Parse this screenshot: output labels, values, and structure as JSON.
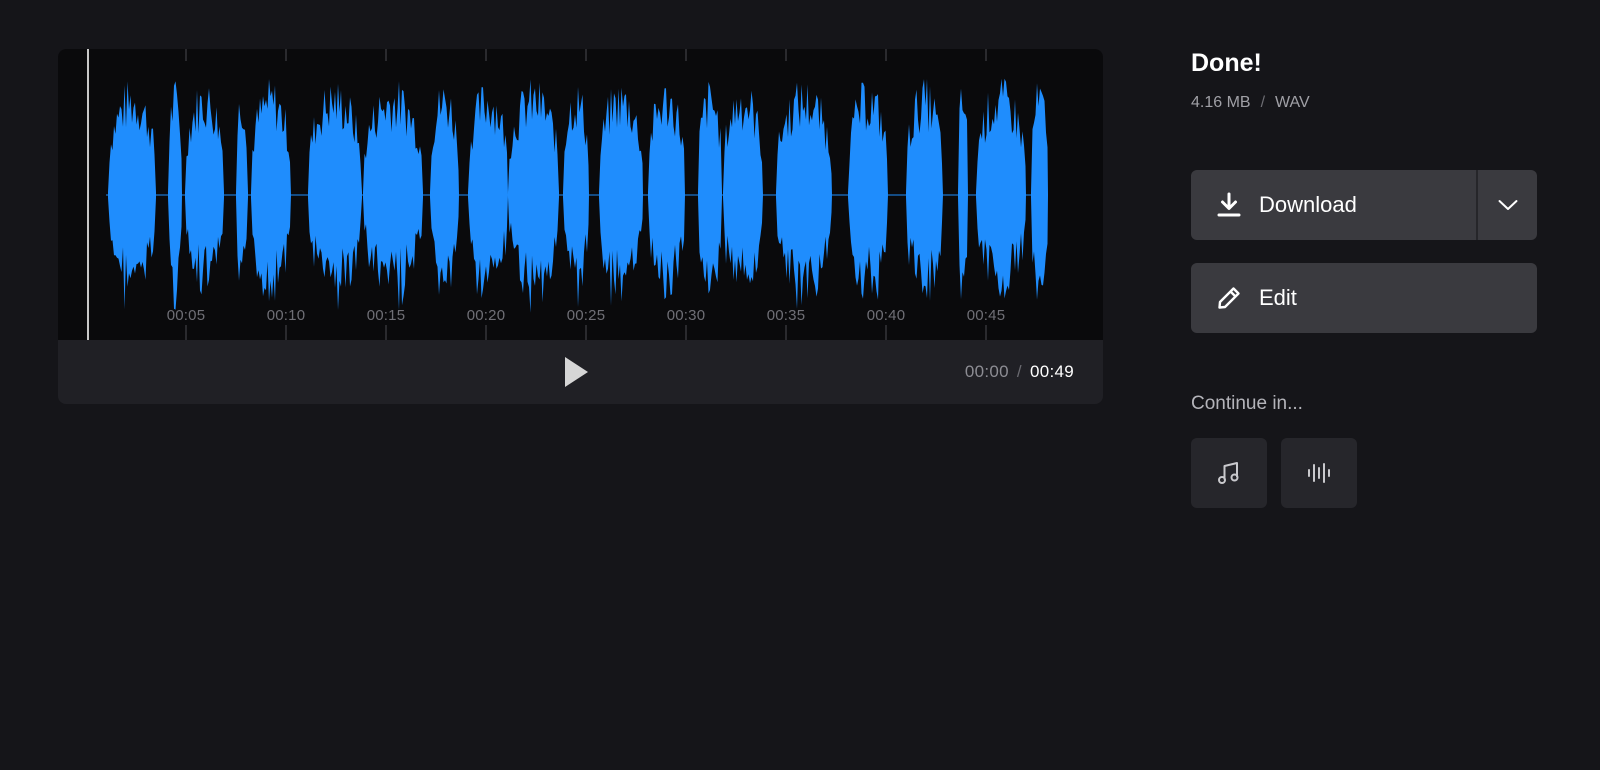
{
  "player": {
    "tick_labels": [
      "00:05",
      "00:10",
      "00:15",
      "00:20",
      "00:25",
      "00:30",
      "00:35",
      "00:40",
      "00:45"
    ],
    "current_time": "00:00",
    "time_separator": "/",
    "total_time": "00:49",
    "waveform_color": "#1f8dfd"
  },
  "file": {
    "status": "Done!",
    "size": "4.16 MB",
    "separator": "/",
    "format": "WAV"
  },
  "actions": {
    "download_label": "Download",
    "download_icon": "download-icon",
    "more_icon": "chevron-down-icon",
    "edit_label": "Edit",
    "edit_icon": "pencil-icon"
  },
  "continue": {
    "label": "Continue in...",
    "apps": [
      {
        "icon": "music-note-icon"
      },
      {
        "icon": "audio-bars-icon"
      }
    ]
  }
}
